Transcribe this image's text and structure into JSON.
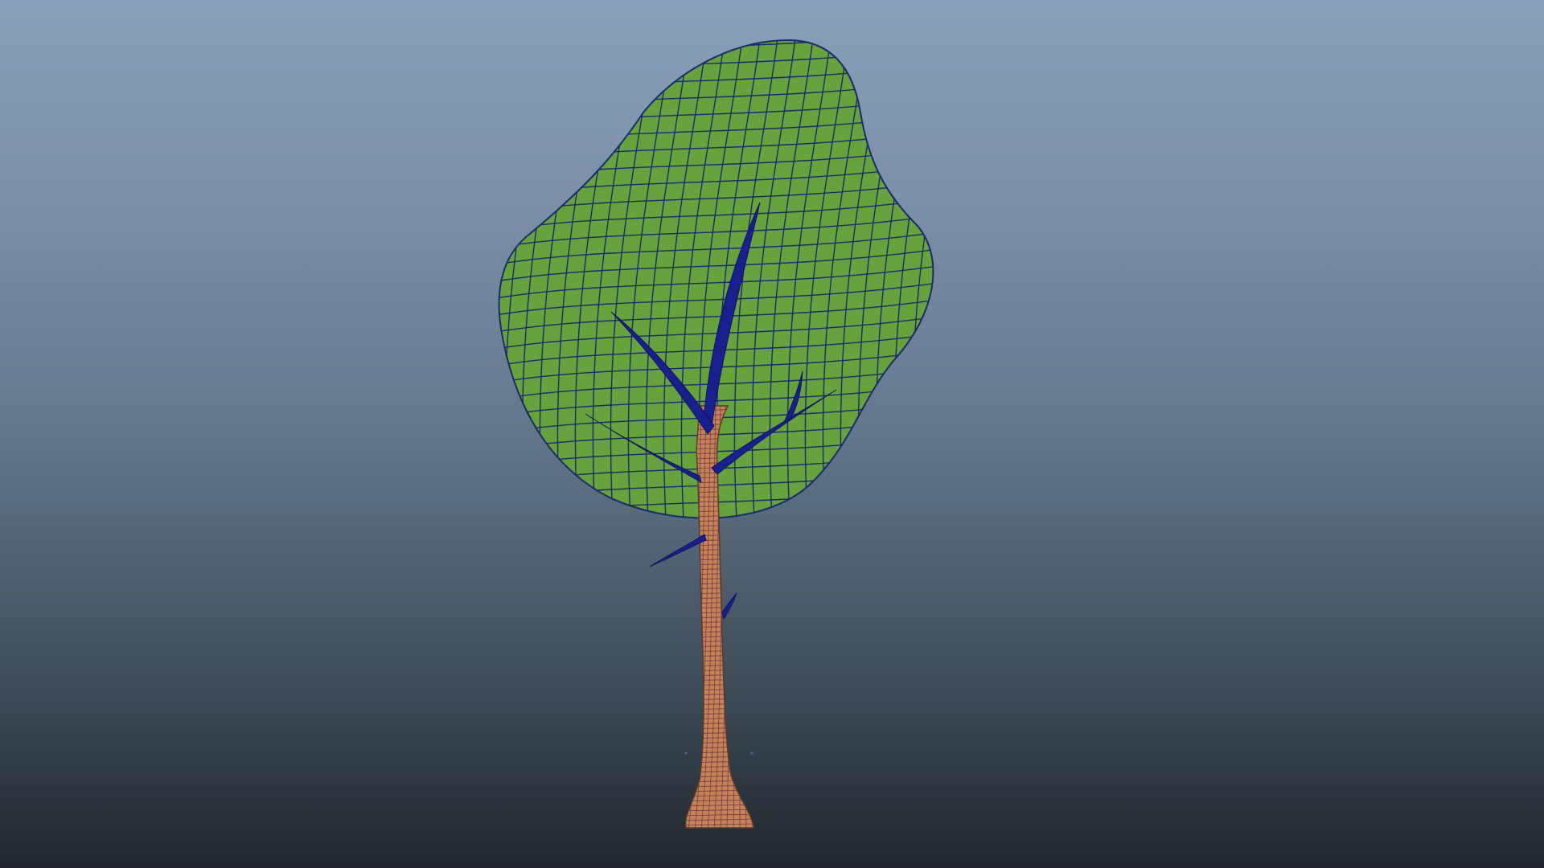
{
  "viewport": {
    "background_top": "#8aa0ba",
    "background_bottom": "#20262c"
  },
  "model": {
    "canopy_color": "#66a33d",
    "wire_color": "#1b2a6b",
    "trunk_color": "#c98256",
    "branch_color": "#1a1f8f"
  }
}
